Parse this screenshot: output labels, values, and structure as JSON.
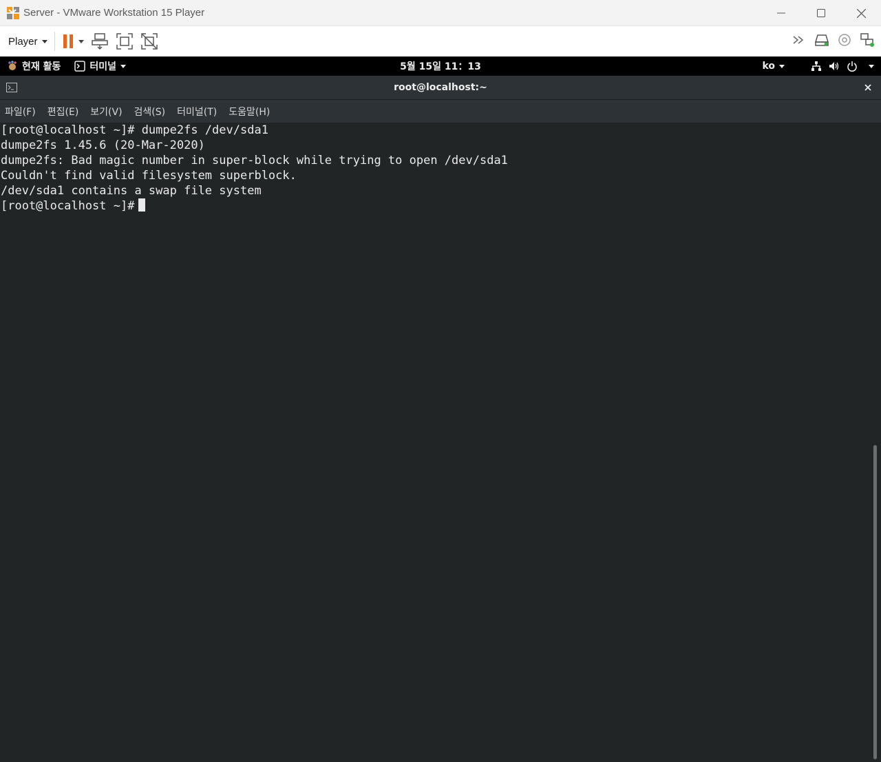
{
  "window": {
    "title": "Server - VMware Workstation 15 Player"
  },
  "toolbar": {
    "player_label": "Player"
  },
  "gnome": {
    "activities": "현재 활동",
    "app_menu": "터미널",
    "clock": "5월 15일  11：13",
    "language": "ko"
  },
  "terminal": {
    "title": "root@localhost:~",
    "menu": [
      "파일(F)",
      "편집(E)",
      "보기(V)",
      "검색(S)",
      "터미널(T)",
      "도움말(H)"
    ],
    "lines": [
      "[root@localhost ~]# dumpe2fs /dev/sda1",
      "dumpe2fs 1.45.6 (20-Mar-2020)",
      "dumpe2fs: Bad magic number in super-block while trying to open /dev/sda1",
      "Couldn't find valid filesystem superblock.",
      "/dev/sda1 contains a swap file system"
    ],
    "prompt": "[root@localhost ~]#"
  },
  "colors": {
    "terminal_bg": "#212526",
    "header_bg": "#2d3237",
    "pause_orange": "#e5661f",
    "gnome_bar": "#000000"
  },
  "icons": [
    "vmware-logo-icon",
    "minimize-icon",
    "maximize-icon",
    "close-icon",
    "pause-icon",
    "send-ctrl-alt-del-icon",
    "fullscreen-icon",
    "unity-icon",
    "chevrons-icon",
    "hard-disk-icon",
    "cd-icon",
    "network-adapter-icon",
    "gnome-foot-icon",
    "terminal-app-icon",
    "network-icon",
    "volume-icon",
    "power-icon"
  ]
}
